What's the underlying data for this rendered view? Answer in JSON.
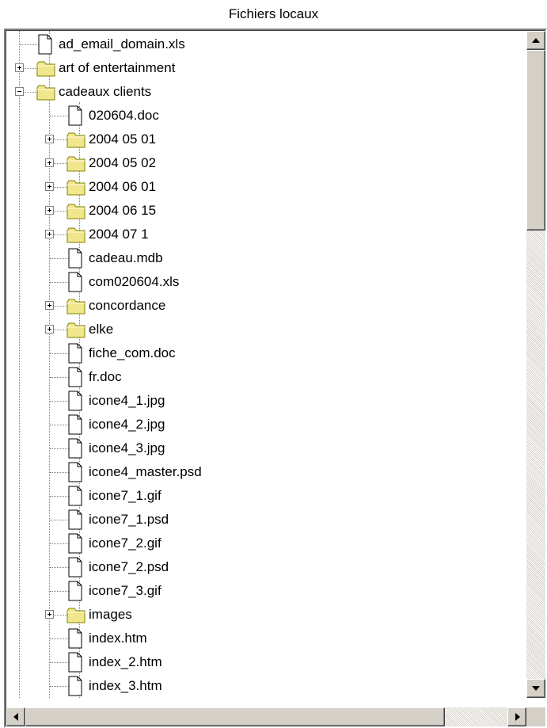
{
  "panel": {
    "title": "Fichiers locaux"
  },
  "tree": {
    "items": [
      {
        "label": "ad_email_domain.xls",
        "type": "file",
        "depth": 1
      },
      {
        "label": "art of entertainment",
        "type": "folder",
        "depth": 1,
        "expanded": false
      },
      {
        "label": "cadeaux clients",
        "type": "folder",
        "depth": 1,
        "expanded": true
      },
      {
        "label": "020604.doc",
        "type": "file",
        "depth": 2
      },
      {
        "label": "2004 05 01",
        "type": "folder",
        "depth": 2,
        "expanded": false
      },
      {
        "label": "2004 05 02",
        "type": "folder",
        "depth": 2,
        "expanded": false
      },
      {
        "label": "2004 06 01",
        "type": "folder",
        "depth": 2,
        "expanded": false
      },
      {
        "label": "2004 06 15",
        "type": "folder",
        "depth": 2,
        "expanded": false
      },
      {
        "label": "2004 07 1",
        "type": "folder",
        "depth": 2,
        "expanded": false
      },
      {
        "label": "cadeau.mdb",
        "type": "file",
        "depth": 2
      },
      {
        "label": "com020604.xls",
        "type": "file",
        "depth": 2
      },
      {
        "label": "concordance",
        "type": "folder",
        "depth": 2,
        "expanded": false
      },
      {
        "label": "elke",
        "type": "folder",
        "depth": 2,
        "expanded": false
      },
      {
        "label": "fiche_com.doc",
        "type": "file",
        "depth": 2
      },
      {
        "label": "fr.doc",
        "type": "file",
        "depth": 2
      },
      {
        "label": "icone4_1.jpg",
        "type": "file",
        "depth": 2
      },
      {
        "label": "icone4_2.jpg",
        "type": "file",
        "depth": 2
      },
      {
        "label": "icone4_3.jpg",
        "type": "file",
        "depth": 2
      },
      {
        "label": "icone4_master.psd",
        "type": "file",
        "depth": 2
      },
      {
        "label": "icone7_1.gif",
        "type": "file",
        "depth": 2
      },
      {
        "label": "icone7_1.psd",
        "type": "file",
        "depth": 2
      },
      {
        "label": "icone7_2.gif",
        "type": "file",
        "depth": 2
      },
      {
        "label": "icone7_2.psd",
        "type": "file",
        "depth": 2
      },
      {
        "label": "icone7_3.gif",
        "type": "file",
        "depth": 2
      },
      {
        "label": "images",
        "type": "folder",
        "depth": 2,
        "expanded": false
      },
      {
        "label": "index.htm",
        "type": "file",
        "depth": 2
      },
      {
        "label": "index_2.htm",
        "type": "file",
        "depth": 2
      },
      {
        "label": "index_3.htm",
        "type": "file",
        "depth": 2
      }
    ]
  },
  "icons": {
    "file": "document-icon",
    "folder": "folder-icon",
    "scroll_up": "arrow-up-icon",
    "scroll_down": "arrow-down-icon",
    "scroll_left": "arrow-left-icon",
    "scroll_right": "arrow-right-icon"
  },
  "colors": {
    "folder_fill": "#f0e68c",
    "folder_edge": "#808000",
    "scrollbar_face": "#d4d0c8",
    "tree_lines": "#808080"
  }
}
